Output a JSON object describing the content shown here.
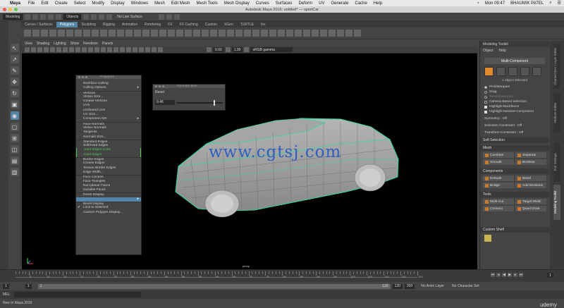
{
  "mac_menu": {
    "app": "Maya",
    "items": [
      "File",
      "Edit",
      "Create",
      "Select",
      "Modify",
      "Display",
      "Windows",
      "Mesh",
      "Edit Mesh",
      "Mesh Tools",
      "Mesh Display",
      "Curves",
      "Surfaces",
      "Deform",
      "UV",
      "Generate",
      "Cache",
      "Help"
    ],
    "clock": "Mon 09:47",
    "user": "BHAUMIK PATEL"
  },
  "window_title": "Autodesk Maya 2016: untitled*  —  sportCar",
  "status_line": {
    "mode": "Modeling",
    "objects": "Objects",
    "live_surface": "No Live Surface"
  },
  "shelf_tabs": [
    "Curves / Surfaces",
    "Polygons",
    "Sculpting",
    "Rigging",
    "Animation",
    "Rendering",
    "FX",
    "FX Caching",
    "Custom",
    "XGen",
    "TURTLE",
    "fxs"
  ],
  "shelf_active": "Polygons",
  "viewport_menu": [
    "View",
    "Shading",
    "Lighting",
    "Show",
    "Renderer",
    "Panels"
  ],
  "viewport_toolbar": {
    "v1": "0.00",
    "v2": "1.00",
    "colorspace": "sRGB gamma"
  },
  "viewport": {
    "camera": "persp",
    "watermark": "www.cgtsj.com"
  },
  "polygons_menu": {
    "title": "Polygons",
    "items": [
      {
        "label": "Backface Culling"
      },
      {
        "label": "Culling Options",
        "arrow": "▸"
      },
      {
        "label": "Vertices",
        "sep": true
      },
      {
        "label": "Vertex Size..."
      },
      {
        "label": "Crease Vertices"
      },
      {
        "label": "UVs"
      },
      {
        "label": "Unshared UVs"
      },
      {
        "label": "UV Size..."
      },
      {
        "label": "Component IDs",
        "arrow": "▸"
      },
      {
        "label": "Face Normals",
        "sep": true
      },
      {
        "label": "Vertex Normals"
      },
      {
        "label": "Tangents"
      },
      {
        "label": "Normals Size..."
      },
      {
        "label": "Standard Edges",
        "sep": true
      },
      {
        "label": "Soft/Hard Edges"
      },
      {
        "label": "Hard Edges Color",
        "green": true
      },
      {
        "label": "Hard Edges",
        "green": true
      },
      {
        "label": "Border Edges",
        "sep": true
      },
      {
        "label": "Crease Edges"
      },
      {
        "label": "Texture Border Edges"
      },
      {
        "label": "Edge Width..."
      },
      {
        "label": "Face Centers",
        "sep": true
      },
      {
        "label": "Face Triangles"
      },
      {
        "label": "Non-planar Faces"
      },
      {
        "label": "Invisible Faces"
      },
      {
        "label": "Reset Display",
        "sep": true
      },
      {
        "label": "",
        "hl": true,
        "arrow": "▸"
      },
      {
        "label": "Bevel Display",
        "sep": true
      },
      {
        "label": "Limit to Selected",
        "check": "✔"
      },
      {
        "label": "Custom Polygon Display..."
      }
    ]
  },
  "normals_size": {
    "title": "Normals Size",
    "reset": "Reset",
    "value": "0.46"
  },
  "modeling_toolkit": {
    "title": "Modeling Toolkit",
    "sub": [
      "Object",
      "Help"
    ],
    "mode": "Multi-Component",
    "selected_note": "1 object selected",
    "options": [
      {
        "label": "Pick/Marquee",
        "kind": "radio",
        "on": true
      },
      {
        "label": "Drag",
        "kind": "radio",
        "on": false
      },
      {
        "label": "Tweak/Marquee",
        "kind": "radio",
        "on": false,
        "dim": true
      },
      {
        "label": "Camera Based Selection",
        "kind": "check",
        "on": false
      },
      {
        "label": "Highlight Backfaces",
        "kind": "check",
        "on": true
      },
      {
        "label": "Highlight Nearest Component",
        "kind": "check",
        "on": true
      }
    ],
    "symmetry": "Symmetry :  Off",
    "sel_constraint": "Selection Constraint :  Off",
    "xform_constraint": "Transform Constraint :  Off",
    "soft_selection": "Soft Selection",
    "mesh_header": "Mesh",
    "mesh_buttons": [
      "Combine",
      "Separate",
      "Smooth",
      "Boolean"
    ],
    "components_header": "Components",
    "component_buttons": [
      "Extrude",
      "Bevel",
      "Bridge",
      "Add Divisions"
    ],
    "tools_header": "Tools",
    "tool_buttons": [
      "Multi-Cut",
      "Target Weld",
      "Connect",
      "Quad Draw"
    ],
    "custom_shelf": "Custom Shelf"
  },
  "side_tabs": [
    "Channel Box / Layer Editor",
    "Attribute Editor",
    "Tool Settings",
    "Modeling Toolkit"
  ],
  "timeline": {
    "ticks": [
      "5",
      "10",
      "15",
      "20",
      "25",
      "30",
      "35",
      "40",
      "45",
      "50",
      "55",
      "60",
      "65",
      "70",
      "75",
      "80",
      "85",
      "90",
      "95",
      "100",
      "105",
      "110",
      "115",
      "120"
    ],
    "frame": "1"
  },
  "range": {
    "start": "1",
    "start2": "1",
    "mid": "1",
    "end": "120",
    "end2": "120",
    "max": "200",
    "anim_layer": "No Anim Layer",
    "char_set": "No Character Set"
  },
  "cmd_label": "MEL",
  "help_line": "New in Maya 2016",
  "brand": "udemy"
}
